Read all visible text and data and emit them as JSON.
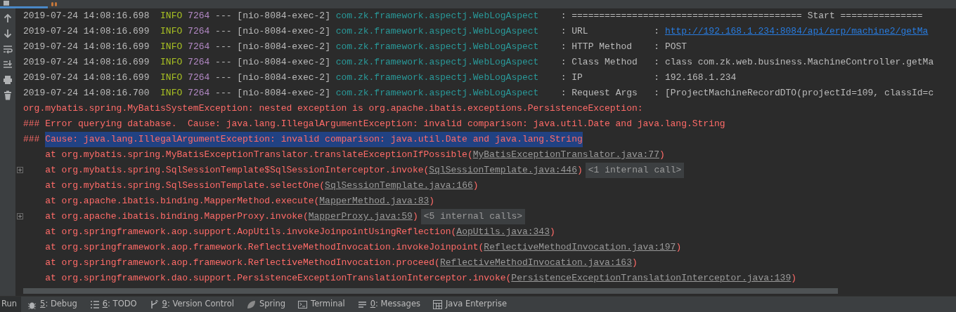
{
  "tabs": [
    {
      "kind": "console",
      "selected": true
    },
    {
      "kind": "endpoints",
      "selected": false
    }
  ],
  "side_toolbar": [
    {
      "kind": "up"
    },
    {
      "kind": "down"
    },
    {
      "kind": "wrap"
    },
    {
      "kind": "scroll-end"
    },
    {
      "kind": "print"
    },
    {
      "kind": "trash"
    }
  ],
  "info_lines": [
    {
      "timestamp": "2019-07-24 14:08:16.698",
      "level": "INFO",
      "pid": "7264",
      "separator": "---",
      "thread": "[nio-8084-exec-2]",
      "logger": "com.zk.framework.aspectj.WebLogAspect",
      "colon": ":",
      "value": "========================================== Start ===============",
      "kind": "plain"
    },
    {
      "timestamp": "2019-07-24 14:08:16.699",
      "level": "INFO",
      "pid": "7264",
      "separator": "---",
      "thread": "[nio-8084-exec-2]",
      "logger": "com.zk.framework.aspectj.WebLogAspect",
      "colon": ":",
      "field": "URL",
      "field_colon": ":",
      "value": "http://192.168.1.234:8084/api/erp/machine2/getMa",
      "kind": "link"
    },
    {
      "timestamp": "2019-07-24 14:08:16.699",
      "level": "INFO",
      "pid": "7264",
      "separator": "---",
      "thread": "[nio-8084-exec-2]",
      "logger": "com.zk.framework.aspectj.WebLogAspect",
      "colon": ":",
      "field": "HTTP Method",
      "field_colon": ":",
      "value": "POST",
      "kind": "plain"
    },
    {
      "timestamp": "2019-07-24 14:08:16.699",
      "level": "INFO",
      "pid": "7264",
      "separator": "---",
      "thread": "[nio-8084-exec-2]",
      "logger": "com.zk.framework.aspectj.WebLogAspect",
      "colon": ":",
      "field": "Class Method",
      "field_colon": ":",
      "value": "class com.zk.web.business.MachineController.getMa",
      "kind": "plain"
    },
    {
      "timestamp": "2019-07-24 14:08:16.699",
      "level": "INFO",
      "pid": "7264",
      "separator": "---",
      "thread": "[nio-8084-exec-2]",
      "logger": "com.zk.framework.aspectj.WebLogAspect",
      "colon": ":",
      "field": "IP",
      "field_colon": ":",
      "value": "192.168.1.234",
      "kind": "plain"
    },
    {
      "timestamp": "2019-07-24 14:08:16.700",
      "level": "INFO",
      "pid": "7264",
      "separator": "---",
      "thread": "[nio-8084-exec-2]",
      "logger": "com.zk.framework.aspectj.WebLogAspect",
      "colon": ":",
      "field": "Request Args",
      "field_colon": ":",
      "value": "[ProjectMachineRecordDTO(projectId=109, classId=c",
      "kind": "plain"
    }
  ],
  "error_lines": [
    {
      "text": "org.mybatis.spring.MyBatisSystemException: nested exception is org.apache.ibatis.exceptions.PersistenceException:",
      "selected": false
    },
    {
      "prefix": "###",
      "text": "Error querying database.  Cause: java.lang.IllegalArgumentException: invalid comparison: java.util.Date and java.lang.String",
      "selected": false
    },
    {
      "prefix": "###",
      "text": "Cause: java.lang.IllegalArgumentException: invalid comparison: java.util.Date and java.lang.String",
      "selected": true
    }
  ],
  "stack_frames": [
    {
      "call": "at org.mybatis.spring.MyBatisExceptionTranslator.translateExceptionIfPossible(",
      "source": "MyBatisExceptionTranslator.java:77",
      "close": ")"
    },
    {
      "call": "at org.mybatis.spring.SqlSessionTemplate$SqlSessionInterceptor.invoke(",
      "source": "SqlSessionTemplate.java:446",
      "close": ")",
      "folded": "<1 internal call>",
      "expanded": false
    },
    {
      "call": "at org.mybatis.spring.SqlSessionTemplate.selectOne(",
      "source": "SqlSessionTemplate.java:166",
      "close": ")"
    },
    {
      "call": "at org.apache.ibatis.binding.MapperMethod.execute(",
      "source": "MapperMethod.java:83",
      "close": ")"
    },
    {
      "call": "at org.apache.ibatis.binding.MapperProxy.invoke(",
      "source": "MapperProxy.java:59",
      "close": ")",
      "folded": "<5 internal calls>",
      "expanded": false
    },
    {
      "call": "at org.springframework.aop.support.AopUtils.invokeJoinpointUsingReflection(",
      "source": "AopUtils.java:343",
      "close": ")"
    },
    {
      "call": "at org.springframework.aop.framework.ReflectiveMethodInvocation.invokeJoinpoint(",
      "source": "ReflectiveMethodInvocation.java:197",
      "close": ")"
    },
    {
      "call": "at org.springframework.aop.framework.ReflectiveMethodInvocation.proceed(",
      "source": "ReflectiveMethodInvocation.java:163",
      "close": ")"
    },
    {
      "call": "at org.springframework.dao.support.PersistenceExceptionTranslationInterceptor.invoke(",
      "source": "PersistenceExceptionTranslationInterceptor.java:139",
      "close": ")"
    }
  ],
  "bottom_bar": [
    {
      "label": "Run",
      "selected": true
    },
    {
      "label": "5: Debug",
      "kind": "bug",
      "mnemonic": true,
      "selected": false
    },
    {
      "label": "6: TODO",
      "kind": "list",
      "mnemonic": true,
      "selected": false
    },
    {
      "label": "9: Version Control",
      "kind": "vcs",
      "mnemonic": true,
      "selected": false
    },
    {
      "label": "Spring",
      "kind": "leaf",
      "selected": false
    },
    {
      "label": "Terminal",
      "kind": "terminal",
      "selected": false
    },
    {
      "label": "0: Messages",
      "kind": "lines",
      "mnemonic": true,
      "selected": false
    },
    {
      "label": "Java Enterprise",
      "kind": "grid",
      "selected": false
    }
  ]
}
